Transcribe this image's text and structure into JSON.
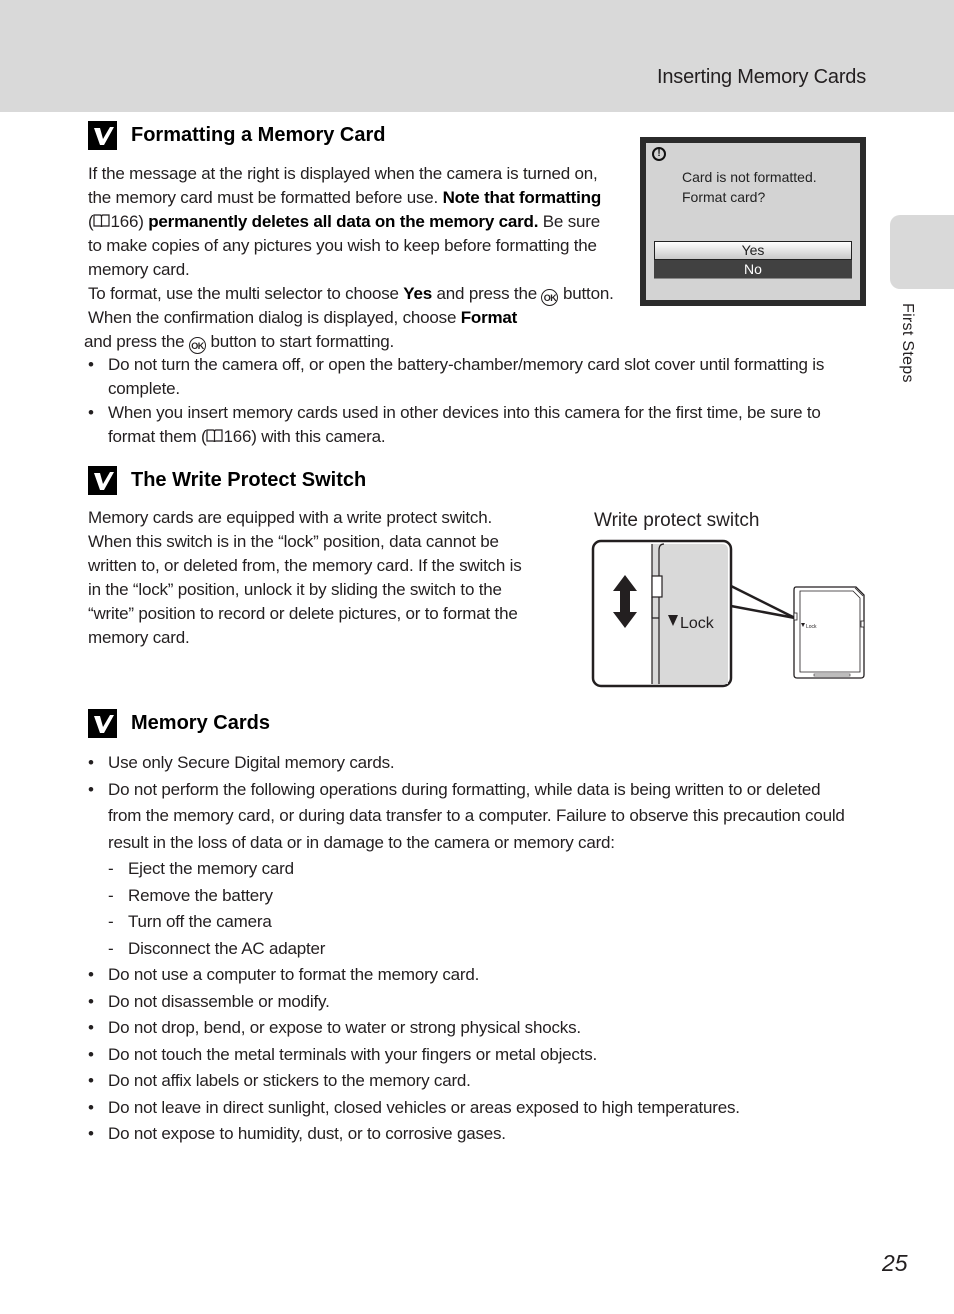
{
  "header": {
    "title": "Inserting Memory Cards"
  },
  "side_tab": {
    "label": "First Steps"
  },
  "sections": {
    "formatting": {
      "title": "Formatting a Memory Card",
      "p1_a": "If the message at the right is displayed when the camera is turned on, the memory card must be formatted before use. ",
      "p1_b": "Note that formatting",
      "p1_c": " (",
      "p1_ref": "166",
      "p1_d": ") ",
      "p1_e": "permanently deletes all data on the memory card.",
      "p1_f": " Be sure to make copies of any pictures you wish to keep before formatting the memory card.",
      "p2_a": "To format, use the multi selector to choose ",
      "p2_b": "Yes",
      "p2_c": " and press the ",
      "p2_d": " button. When the confirmation dialog is displayed, choose ",
      "p2_e": "Format",
      "p2_f": " and press the ",
      "p2_g": " button to start formatting.",
      "ok_label": "OK",
      "bullets": [
        "Do not turn the camera off, or open the battery-chamber/memory card slot cover until formatting is complete.",
        {
          "a": "When you insert memory cards used in other devices into this camera for the first time, be sure to format them (",
          "ref": "166",
          "b": ") with this camera."
        }
      ]
    },
    "write_protect": {
      "title": "The Write Protect Switch",
      "body": "Memory cards are equipped with a write protect switch. When this switch is in the “lock” position, data cannot be written to, or deleted from, the memory card. If the switch is in the “lock” position, unlock it by sliding the switch to the “write” position to record or delete pictures, or to format the memory card.",
      "figure_label": "Write protect switch",
      "lock_label": "Lock",
      "small_lock_label": "Lock"
    },
    "memory_cards": {
      "title": "Memory Cards",
      "bullets": [
        "Use only Secure Digital memory cards.",
        "Do not perform the following operations during formatting, while data is being written to or deleted from the memory card, or during data transfer to a computer. Failure to observe this precaution could result in the loss of data or in damage to the camera or memory card:"
      ],
      "sub_items": [
        "Eject the memory card",
        "Remove the battery",
        "Turn off the camera",
        "Disconnect the AC adapter"
      ],
      "more_bullets": [
        "Do not use a computer to format the memory card.",
        "Do not disassemble or modify.",
        "Do not drop, bend, or expose to water or strong physical shocks.",
        "Do not touch the metal terminals with your fingers or metal objects.",
        "Do not affix labels or stickers to the memory card.",
        "Do not leave in direct sunlight, closed vehicles or areas exposed to high temperatures.",
        "Do not expose to humidity, dust, or to corrosive gases."
      ]
    }
  },
  "camera_screen": {
    "icon": "warning-icon",
    "message_line1": "Card is not formatted.",
    "message_line2": "Format card?",
    "options": [
      "Yes",
      "No"
    ],
    "selected": "Yes"
  },
  "page_number": "25"
}
